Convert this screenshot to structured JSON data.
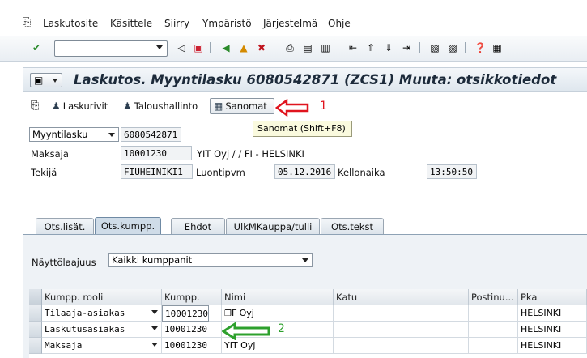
{
  "menu": {
    "items": [
      "Laskutosite",
      "Käsittele",
      "Siirry",
      "Ympäristö",
      "Järjestelmä",
      "Ohje"
    ],
    "underline": [
      "L",
      "K",
      "S",
      "Y",
      "J",
      "O"
    ]
  },
  "command_field": {
    "value": "",
    "placeholder": ""
  },
  "title": "Laskutos. Myyntilasku 6080542871 (ZCS1) Muuta: otsikkotiedot",
  "app_toolbar": {
    "laskurivit": "Laskurivit",
    "taloushallinto": "Taloushallinto",
    "sanomat": "Sanomat"
  },
  "tooltip": "Sanomat   (Shift+F8)",
  "annotations": {
    "one": "1",
    "two": "2",
    "red": "#e0141e",
    "green": "#2da02d"
  },
  "header": {
    "doc_type": "Myyntilasku",
    "doc_number": "6080542871",
    "payer_label": "Maksaja",
    "payer_value": "10001230",
    "payer_name": "YIT Oyj /  / FI -  HELSINKI",
    "creator_label": "Tekijä",
    "creator_value": "FIUHEINIKI1",
    "created_on_label": "Luontipvm",
    "created_on_value": "05.12.2016",
    "time_label": "Kellonaika",
    "time_value": "13:50:50"
  },
  "tabs": [
    "Ots.lisät.",
    "Ots.kumpp.",
    "Ehdot",
    "UlkMKauppa/tulli",
    "Ots.tekst"
  ],
  "active_tab": 1,
  "display_scope": {
    "label": "Näyttölaajuus",
    "value": "Kaikki kumppanit"
  },
  "table": {
    "columns": [
      "Kumpp. rooli",
      "Kumpp.",
      "Nimi",
      "Katu",
      "Postinu...",
      "Pka"
    ],
    "rows": [
      {
        "role": "Tilaaja-asiakas",
        "partner": "10001230",
        "name": "Γ Oyj",
        "street": "",
        "postal": "",
        "city": "HELSINKI"
      },
      {
        "role": "Laskutusasiakas",
        "partner": "10001230",
        "name": "",
        "street": "",
        "postal": "",
        "city": "HELSINKI"
      },
      {
        "role": "Maksaja",
        "partner": "10001230",
        "name": "YIT Oyj",
        "street": "",
        "postal": "",
        "city": "HELSINKI"
      }
    ]
  }
}
